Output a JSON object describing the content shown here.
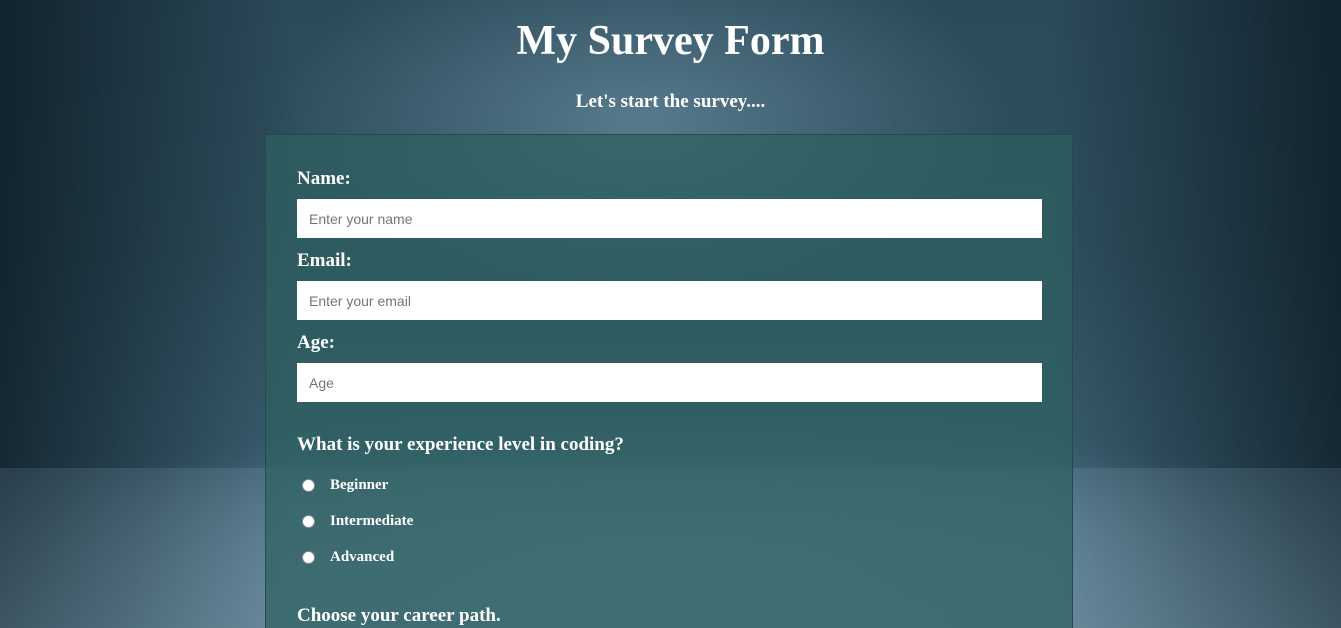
{
  "header": {
    "title": "My Survey Form",
    "subtitle": "Let's start the survey...."
  },
  "form": {
    "name": {
      "label": "Name:",
      "placeholder": "Enter your name",
      "value": ""
    },
    "email": {
      "label": "Email:",
      "placeholder": "Enter your email",
      "value": ""
    },
    "age": {
      "label": "Age:",
      "placeholder": "Age",
      "value": ""
    },
    "experience": {
      "question": "What is your experience level in coding?",
      "options": [
        {
          "label": "Beginner",
          "checked": false
        },
        {
          "label": "Intermediate",
          "checked": false
        },
        {
          "label": "Advanced",
          "checked": false
        }
      ]
    },
    "career": {
      "question": "Choose your career path."
    }
  },
  "colors": {
    "card_background": "#2d5f5f",
    "input_background": "#ffffff",
    "text": "#ffffff"
  }
}
